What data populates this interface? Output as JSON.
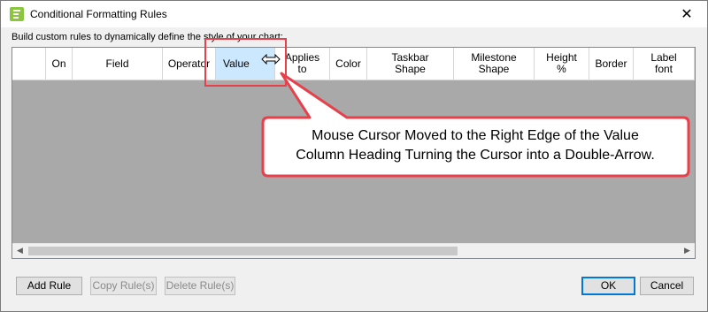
{
  "window": {
    "title": "Conditional Formatting Rules",
    "close_glyph": "✕",
    "app_icon": "gantt-app-icon"
  },
  "hint": "Build custom rules to dynamically define the style of your chart:",
  "columns": [
    {
      "label": ""
    },
    {
      "label": "On"
    },
    {
      "label": "Field"
    },
    {
      "label": "Operator"
    },
    {
      "label": "Value"
    },
    {
      "label": "Applies\nto"
    },
    {
      "label": "Color"
    },
    {
      "label": "Taskbar\nShape"
    },
    {
      "label": "Milestone\nShape"
    },
    {
      "label": "Height\n%"
    },
    {
      "label": "Border"
    },
    {
      "label": "Label\nfont"
    }
  ],
  "scrollbar": {
    "left_arrow": "◀",
    "right_arrow": "▶"
  },
  "buttons": {
    "add_rule": "Add Rule",
    "copy_rules": "Copy Rule(s)",
    "delete_rules": "Delete Rule(s)",
    "ok": "OK",
    "cancel": "Cancel"
  },
  "annotation": {
    "text": "Mouse Cursor Moved to the Right Edge of the Value Column Heading Turning the Cursor into a Double-Arrow.",
    "line1": "Mouse Cursor Moved to the Right Edge of the Value",
    "line2": "Column Heading Turning the Cursor into a Double-Arrow.",
    "color": "#e8404a"
  },
  "colors": {
    "selected_header": "#cce8ff",
    "grid_empty": "#a9a9a9",
    "default_button_border": "#0078d7"
  }
}
